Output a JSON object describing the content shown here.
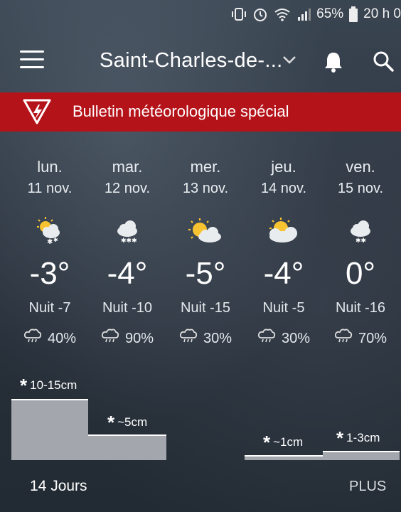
{
  "status_bar": {
    "battery": "65%",
    "time": "20 h 0"
  },
  "header": {
    "location": "Saint-Charles-de-..."
  },
  "alert": {
    "text": "Bulletin météorologique spécial",
    "color": "#b5131a"
  },
  "days": [
    {
      "day": "lun.",
      "date": "11 nov.",
      "temp": "-3°",
      "night": "Nuit -7",
      "precip": "40%",
      "icon": "sun-cloud-snow-icon"
    },
    {
      "day": "mar.",
      "date": "12 nov.",
      "temp": "-4°",
      "night": "Nuit -10",
      "precip": "90%",
      "icon": "cloud-snow-icon"
    },
    {
      "day": "mer.",
      "date": "13 nov.",
      "temp": "-5°",
      "night": "Nuit -15",
      "precip": "30%",
      "icon": "sun-cloud-icon"
    },
    {
      "day": "jeu.",
      "date": "14 nov.",
      "temp": "-4°",
      "night": "Nuit -5",
      "precip": "30%",
      "icon": "sun-cloud-icon"
    },
    {
      "day": "ven.",
      "date": "15 nov.",
      "temp": "0°",
      "night": "Nuit -16",
      "precip": "70%",
      "icon": "cloud-snow-icon"
    }
  ],
  "snow": [
    {
      "label": "10-15cm"
    },
    {
      "label": "~5cm"
    },
    {
      "label": "~1cm"
    },
    {
      "label": "1-3cm"
    }
  ],
  "footer": {
    "left": "14 Jours",
    "right": "PLUS"
  }
}
